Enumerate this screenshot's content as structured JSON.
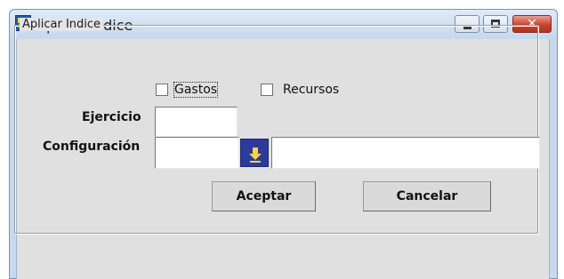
{
  "window": {
    "title": "Aplicar Indice",
    "close_glyph": "✕"
  },
  "group": {
    "label": "Aplicar Indice"
  },
  "checkboxes": {
    "gastos": {
      "label": "Gastos",
      "checked": false
    },
    "recursos": {
      "label": "Recursos",
      "checked": false
    }
  },
  "fields": {
    "ejercicio": {
      "label": "Ejercicio",
      "value": ""
    },
    "configuracion": {
      "label": "Configuración",
      "code_value": "",
      "description_value": ""
    }
  },
  "buttons": {
    "aceptar": "Aceptar",
    "cancelar": "Cancelar"
  },
  "icons": {
    "app": "app-icon",
    "lookup": "download-arrow-icon"
  }
}
